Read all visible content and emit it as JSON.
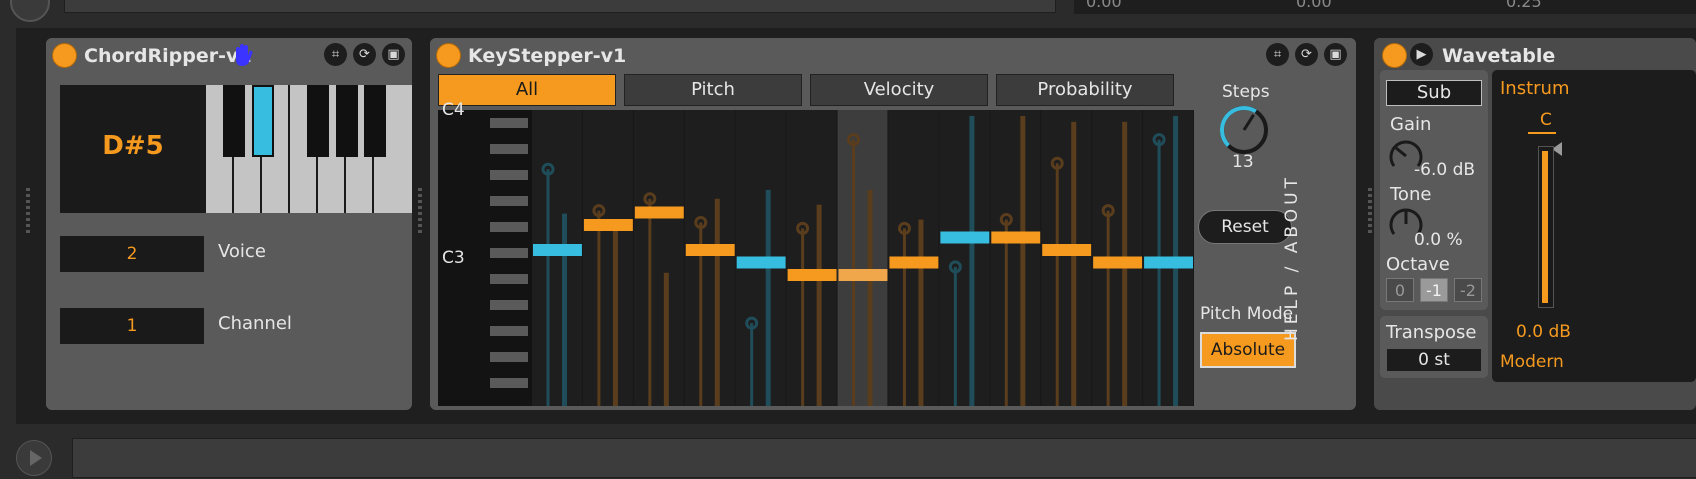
{
  "colors": {
    "accent": "#f59a1e",
    "cyan": "#36bde0",
    "panel": "#5a5a5a",
    "dark": "#1a1a1a"
  },
  "top": {
    "values": [
      "0.00",
      "0.00",
      "0.25"
    ]
  },
  "chordripper": {
    "title": "ChordRipper-v1",
    "note": "D#5",
    "voice_value": "2",
    "voice_label": "Voice",
    "channel_value": "1",
    "channel_label": "Channel"
  },
  "keystepper": {
    "title": "KeyStepper-v1",
    "tabs": [
      "All",
      "Pitch",
      "Velocity",
      "Probability"
    ],
    "active_tab": "All",
    "grid_labels": {
      "top": "C4",
      "mid": "C3"
    },
    "steps_label": "Steps",
    "steps_value": "13",
    "steps_fraction": 0.62,
    "reset_label": "Reset",
    "pitch_mode_label": "Pitch Mode",
    "pitch_mode_value": "Absolute",
    "help_label": "HELP / ABOUT",
    "step_count": 13,
    "active_step": 7,
    "steps": [
      {
        "pitch": 0,
        "color": "cyan",
        "vel": 0.8,
        "prob": 0.65
      },
      {
        "pitch": 2,
        "color": "orange",
        "vel": 0.66,
        "prob": 0.6
      },
      {
        "pitch": 3,
        "color": "orange",
        "vel": 0.7,
        "prob": 0.45
      },
      {
        "pitch": 0,
        "color": "orange",
        "vel": 0.62,
        "prob": 0.7
      },
      {
        "pitch": -1,
        "color": "cyan",
        "vel": 0.28,
        "prob": 0.73
      },
      {
        "pitch": -2,
        "color": "orange",
        "vel": 0.6,
        "prob": 0.68
      },
      {
        "pitch": -2,
        "color": "orange",
        "vel": 0.9,
        "prob": 0.73
      },
      {
        "pitch": -1,
        "color": "orange",
        "vel": 0.6,
        "prob": 0.63
      },
      {
        "pitch": 1,
        "color": "cyan",
        "vel": 0.47,
        "prob": 0.98
      },
      {
        "pitch": 1,
        "color": "orange",
        "vel": 0.63,
        "prob": 0.98
      },
      {
        "pitch": 0,
        "color": "orange",
        "vel": 0.82,
        "prob": 0.96
      },
      {
        "pitch": -1,
        "color": "orange",
        "vel": 0.66,
        "prob": 0.96
      },
      {
        "pitch": -1,
        "color": "cyan",
        "vel": 0.9,
        "prob": 0.98
      }
    ]
  },
  "wavetable": {
    "title": "Wavetable",
    "sub_label": "Sub",
    "gain_label": "Gain",
    "gain_value": "-6.0 dB",
    "tone_label": "Tone",
    "tone_value": "0.0 %",
    "octave_label": "Octave",
    "octave_options": [
      "0",
      "-1",
      "-2"
    ],
    "octave_selected": "-1",
    "transpose_label": "Transpose",
    "transpose_value": "0 st",
    "instrument_label": "Instrum",
    "note_label": "C",
    "level_value": "0.0 dB",
    "mode_label": "Modern"
  }
}
